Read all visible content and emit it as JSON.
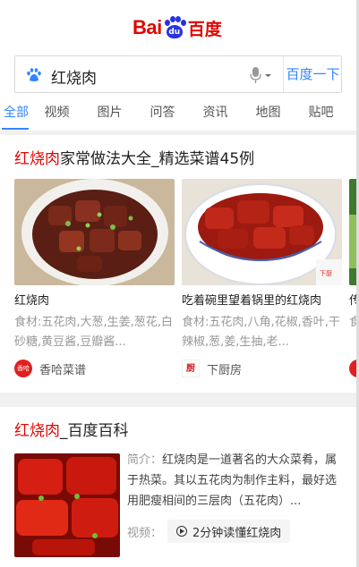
{
  "logo": {
    "text_bai": "Bai",
    "text_du": "du",
    "text_cn": "百度"
  },
  "search": {
    "query": "红烧肉",
    "button_label": "百度一下"
  },
  "tabs": [
    {
      "label": "全部",
      "active": true
    },
    {
      "label": "视频"
    },
    {
      "label": "图片"
    },
    {
      "label": "问答"
    },
    {
      "label": "资讯"
    },
    {
      "label": "地图"
    },
    {
      "label": "贴吧"
    }
  ],
  "recipes": {
    "title_highlight": "红烧肉",
    "title_rest": "家常做法大全_精选菜谱45例",
    "items": [
      {
        "name": "红烧肉",
        "desc": "食材:五花肉,大葱,生姜,葱花,白砂糖,黄豆酱,豆瓣酱...",
        "source": "香哈菜谱",
        "badge": "香哈"
      },
      {
        "name": "吃着碗里望着锅里的红烧肉",
        "desc": "食材:五花肉,八角,花椒,香叶,干辣椒,葱,姜,生抽,老...",
        "source": "下厨房",
        "badge": "厨"
      },
      {
        "name": "传",
        "desc": "食叶",
        "source": "",
        "badge": ""
      }
    ]
  },
  "baike": {
    "title_highlight": "红烧肉",
    "title_rest": "_百度百科",
    "intro_label": "简介：",
    "intro_text": "红烧肉是一道著名的大众菜肴，属于热菜。其以五花肉为制作主料，最好选用肥瘦相间的三层肉（五花肉）...",
    "video_label": "视频：",
    "video_button": "2分钟读懂红烧肉"
  },
  "colors": {
    "brand_red": "#e10601",
    "brand_blue": "#2932e1",
    "link_blue": "#3385ff"
  }
}
